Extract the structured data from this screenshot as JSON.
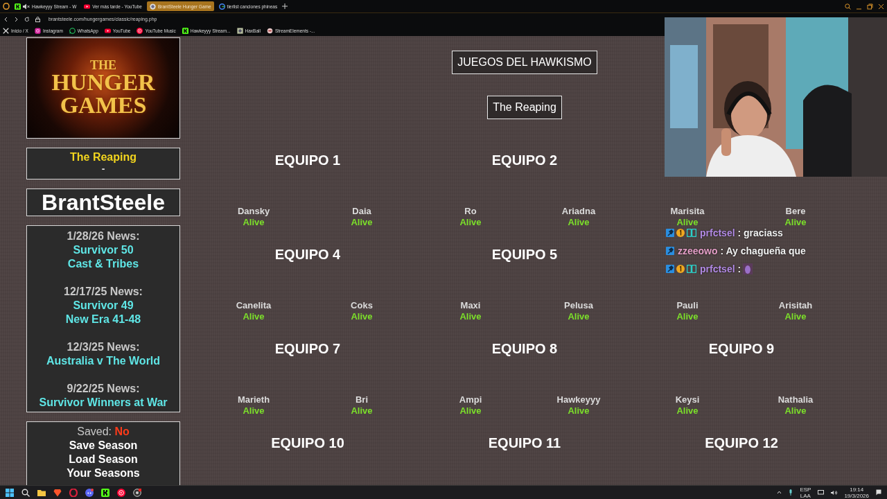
{
  "browser": {
    "tabs": [
      {
        "label": "Hawkeyyy Stream - W",
        "muted": true,
        "selected": false
      },
      {
        "label": "Ver más tarde - YouTube",
        "muted": false,
        "selected": false
      },
      {
        "label": "BrantSteele Hunger Game",
        "muted": false,
        "selected": true
      },
      {
        "label": "tierlist canciones phineas",
        "muted": false,
        "selected": false
      }
    ],
    "url": "brantsteele.com/hungergames/classic/reaping.php",
    "bookmarks": [
      {
        "label": "Inicio / X"
      },
      {
        "label": "Instagram"
      },
      {
        "label": "WhatsApp"
      },
      {
        "label": "YouTube"
      },
      {
        "label": "YouTube Music"
      },
      {
        "label": "Hawkeyyy Stream..."
      },
      {
        "label": "HaxBall"
      },
      {
        "label": "StreamElements -..."
      }
    ]
  },
  "sidebar": {
    "logo": {
      "top": "THE",
      "middle": "HUNGER",
      "bottom": "GAMES"
    },
    "status": {
      "title": "The Reaping",
      "subtitle": "-"
    },
    "brand": "BrantSteele",
    "news": [
      {
        "date": "1/28/26 News:",
        "lines": [
          "Survivor 50",
          "Cast & Tribes"
        ]
      },
      {
        "date": "12/17/25 News:",
        "lines": [
          "Survivor 49",
          "New Era 41-48"
        ]
      },
      {
        "date": "12/3/25 News:",
        "lines": [
          "Australia v The World"
        ]
      },
      {
        "date": "9/22/25 News:",
        "lines": [
          "Survivor Winners at War"
        ]
      }
    ],
    "menu": {
      "saved_label": "Saved:",
      "saved_value": "No",
      "items": [
        "Save Season",
        "Load Season",
        "Your Seasons"
      ]
    }
  },
  "main": {
    "title": "JUEGOS DEL HAWKISMO",
    "subtitle": "The Reaping",
    "teams": [
      {
        "name": "EQUIPO 1",
        "players": [
          {
            "name": "Dansky",
            "status": "Alive"
          },
          {
            "name": "Daia",
            "status": "Alive"
          }
        ]
      },
      {
        "name": "EQUIPO 2",
        "players": [
          {
            "name": "Ro",
            "status": "Alive"
          },
          {
            "name": "Ariadna",
            "status": "Alive"
          }
        ]
      },
      {
        "players": [
          {
            "name": "Marisita",
            "status": "Alive"
          },
          {
            "name": "Bere",
            "status": "Alive"
          }
        ]
      },
      {
        "name": "EQUIPO 4",
        "players": [
          {
            "name": "Canelita",
            "status": "Alive"
          },
          {
            "name": "Coks",
            "status": "Alive"
          }
        ]
      },
      {
        "name": "EQUIPO 5",
        "players": [
          {
            "name": "Maxi",
            "status": "Alive"
          },
          {
            "name": "Pelusa",
            "status": "Alive"
          }
        ]
      },
      {
        "players": [
          {
            "name": "Pauli",
            "status": "Alive"
          },
          {
            "name": "Arisitah",
            "status": "Alive"
          }
        ]
      },
      {
        "name": "EQUIPO 7",
        "players": [
          {
            "name": "Marieth",
            "status": "Alive"
          },
          {
            "name": "Bri",
            "status": "Alive"
          }
        ]
      },
      {
        "name": "EQUIPO 8",
        "players": [
          {
            "name": "Ampi",
            "status": "Alive"
          },
          {
            "name": "Hawkeyyy",
            "status": "Alive"
          }
        ]
      },
      {
        "name": "EQUIPO 9",
        "players": [
          {
            "name": "Keysi",
            "status": "Alive"
          },
          {
            "name": "Nathalia",
            "status": "Alive"
          }
        ]
      },
      {
        "name": "EQUIPO 10"
      },
      {
        "name": "EQUIPO 11"
      },
      {
        "name": "EQUIPO 12"
      }
    ]
  },
  "stream_overlay": {
    "chat": [
      {
        "user": "prfctsel",
        "color": "#b48ce6",
        "text": ": graciass",
        "kind": "text"
      },
      {
        "user": "zzeeowo",
        "color": "#e6a0c8",
        "text": ": Ay chagueña que",
        "kind": "text"
      },
      {
        "user": "prfctsel",
        "color": "#b48ce6",
        "text": ":",
        "kind": "emote"
      }
    ]
  },
  "taskbar": {
    "tray": {
      "lang_top": "ESP",
      "lang_bottom": "LAA",
      "time": "19:14",
      "date": "19/3/2026"
    }
  }
}
